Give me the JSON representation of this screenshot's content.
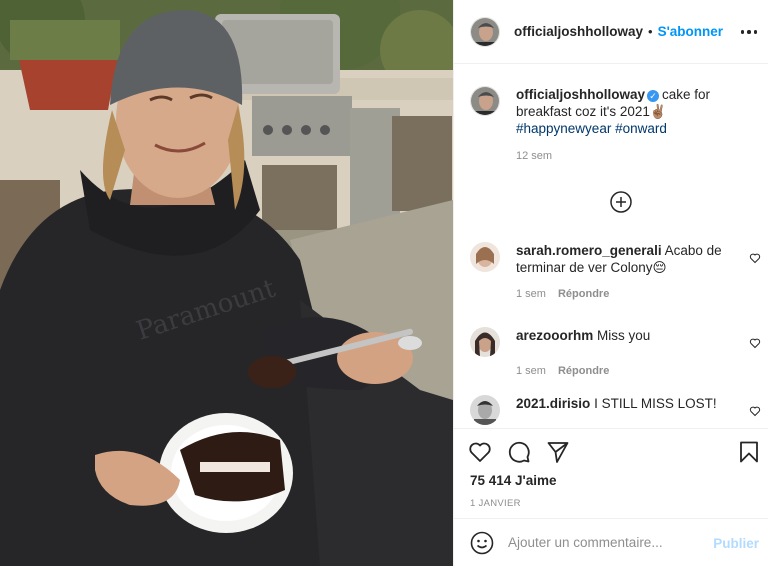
{
  "post": {
    "author": "officialjoshholloway",
    "follow_label": "S'abonner",
    "separator": "•",
    "caption_text": "cake for breakfast coz it's 2021✌🏽",
    "hashtags": [
      "#happynewyear",
      "#onward"
    ],
    "caption_time": "12 sem",
    "likes": "75 414 J'aime",
    "date": "1 JANVIER"
  },
  "comments": [
    {
      "user": "sarah.romero_generali",
      "text": "Acabo de terminar de ver Colony😔",
      "time": "1 sem",
      "reply_label": "Répondre",
      "avatar_color": "#d9b5a0"
    },
    {
      "user": "arezooorhm",
      "text": "Miss you",
      "time": "1 sem",
      "reply_label": "Répondre",
      "avatar_color": "#3a2a28"
    },
    {
      "user": "2021.dirisio",
      "text": "I STILL MISS LOST!",
      "avatar_color": "#6e6e6e"
    }
  ],
  "composer": {
    "placeholder": "Ajouter un commentaire...",
    "publish_label": "Publier"
  },
  "icons": {
    "more": "more-options-icon",
    "verified": "verified-badge-icon",
    "load_more": "plus-circle-icon",
    "heart": "heart-icon",
    "comment": "comment-bubble-icon",
    "share": "paper-plane-icon",
    "save": "bookmark-icon",
    "emoji": "smiley-icon"
  },
  "colors": {
    "link": "#0095f6",
    "hashtag": "#00376b",
    "muted": "#8e8e8e",
    "verified": "#3897f0",
    "publish_disabled": "#b3dbff"
  }
}
